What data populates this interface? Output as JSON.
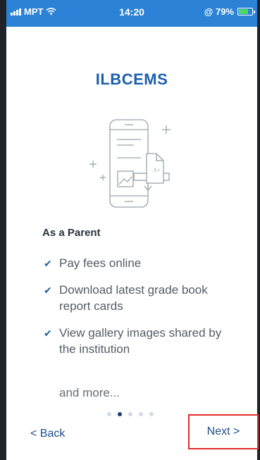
{
  "status_bar": {
    "carrier": "MPT",
    "time": "14:20",
    "battery_percent": "@ 79%",
    "battery_level": 0.79
  },
  "app": {
    "title": "ILBCEMS"
  },
  "onboarding": {
    "role_heading": "As a Parent",
    "features": [
      "Pay fees online",
      "Download latest grade book report cards",
      "View gallery images shared by the institution"
    ],
    "more_text": "and more...",
    "page_indicator": {
      "total": 5,
      "current": 2
    }
  },
  "navigation": {
    "back_label": "< Back",
    "next_label": "Next >"
  },
  "colors": {
    "status_bar": "#2b82d6",
    "brand": "#1c5fae",
    "highlight_border": "#e22b2b"
  }
}
